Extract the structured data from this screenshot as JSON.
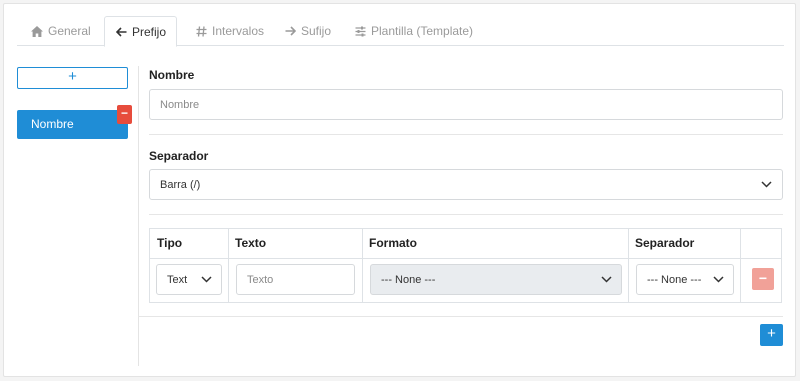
{
  "tabs": [
    {
      "label": "General",
      "icon": "home-icon",
      "active": false
    },
    {
      "label": "Prefijo",
      "icon": "arrow-left-icon",
      "active": true
    },
    {
      "label": "Intervalos",
      "icon": "hash-icon",
      "active": false
    },
    {
      "label": "Sufijo",
      "icon": "arrow-right-icon",
      "active": false
    },
    {
      "label": "Plantilla (Template)",
      "icon": "sliders-icon",
      "active": false
    }
  ],
  "sidebar": {
    "add_label": "+",
    "items": [
      {
        "label": "Nombre",
        "delete_label": "−"
      }
    ]
  },
  "form": {
    "nombre_label": "Nombre",
    "nombre_placeholder": "Nombre",
    "separador_label": "Separador",
    "separador_value": "Barra (/)"
  },
  "table": {
    "headers": [
      "Tipo",
      "Texto",
      "Formato",
      "Separador"
    ],
    "row": {
      "tipo": "Text",
      "texto_placeholder": "Texto",
      "formato": "--- None ---",
      "separador": "--- None ---",
      "delete_label": "−"
    }
  },
  "add_row_label": "+",
  "colors": {
    "accent": "#1f8dd6",
    "danger": "#e74c3c",
    "danger_light": "#f1a198"
  }
}
